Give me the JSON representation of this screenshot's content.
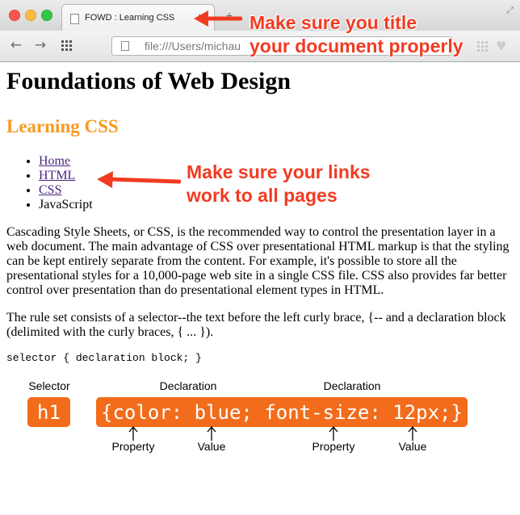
{
  "browser": {
    "tab_title": "FOWD : Learning CSS",
    "tab_close": "✕",
    "url": "file:///Users/michau",
    "back_glyph": "←",
    "forward_glyph": "→",
    "new_tab_glyph": "+",
    "heart_glyph": "♥",
    "fullscreen_glyph": "⤢",
    "icons": [
      "back-arrow-icon",
      "forward-arrow-icon",
      "apps-grid-icon",
      "page-icon",
      "heart-icon"
    ]
  },
  "page": {
    "title": "Foundations of Web Design",
    "subtitle": "Learning CSS",
    "nav": [
      {
        "label": "Home",
        "link": true
      },
      {
        "label": "HTML",
        "link": true
      },
      {
        "label": "CSS",
        "link": true
      },
      {
        "label": "JavaScript",
        "link": false
      }
    ],
    "para1": "Cascading Style Sheets, or CSS, is the recommended way to control the presentation layer in a web document. The main advantage of CSS over presentational HTML markup is that the styling can be kept entirely separate from the content. For example, it's possible to store all the presentational styles for a 10,000-page web site in a single CSS file. CSS also provides far better control over presentation than do presentational element types in HTML.",
    "para2": "The rule set consists of a selector--the text before the left curly brace, {-- and a declaration block (delimited with the curly braces, { ... }).",
    "code": "selector { declaration block; }"
  },
  "diagram": {
    "selector_label": "Selector",
    "declaration_label_1": "Declaration",
    "declaration_label_2": "Declaration",
    "selector_code": "h1",
    "declaration_code": "{color: blue; font-size: 12px;}",
    "property_label_1": "Property",
    "value_label_1": "Value",
    "property_label_2": "Property",
    "value_label_2": "Value"
  },
  "annotations": {
    "title_note_line1": "Make sure you title",
    "title_note_line2": "your document properly",
    "links_note_line1": "Make sure your links",
    "links_note_line2": "work to all pages"
  },
  "colors": {
    "accent_orange": "#f79a21",
    "pill_orange": "#f26c1b",
    "annotation_red": "#f13b22",
    "link_purple": "#4a2580"
  }
}
